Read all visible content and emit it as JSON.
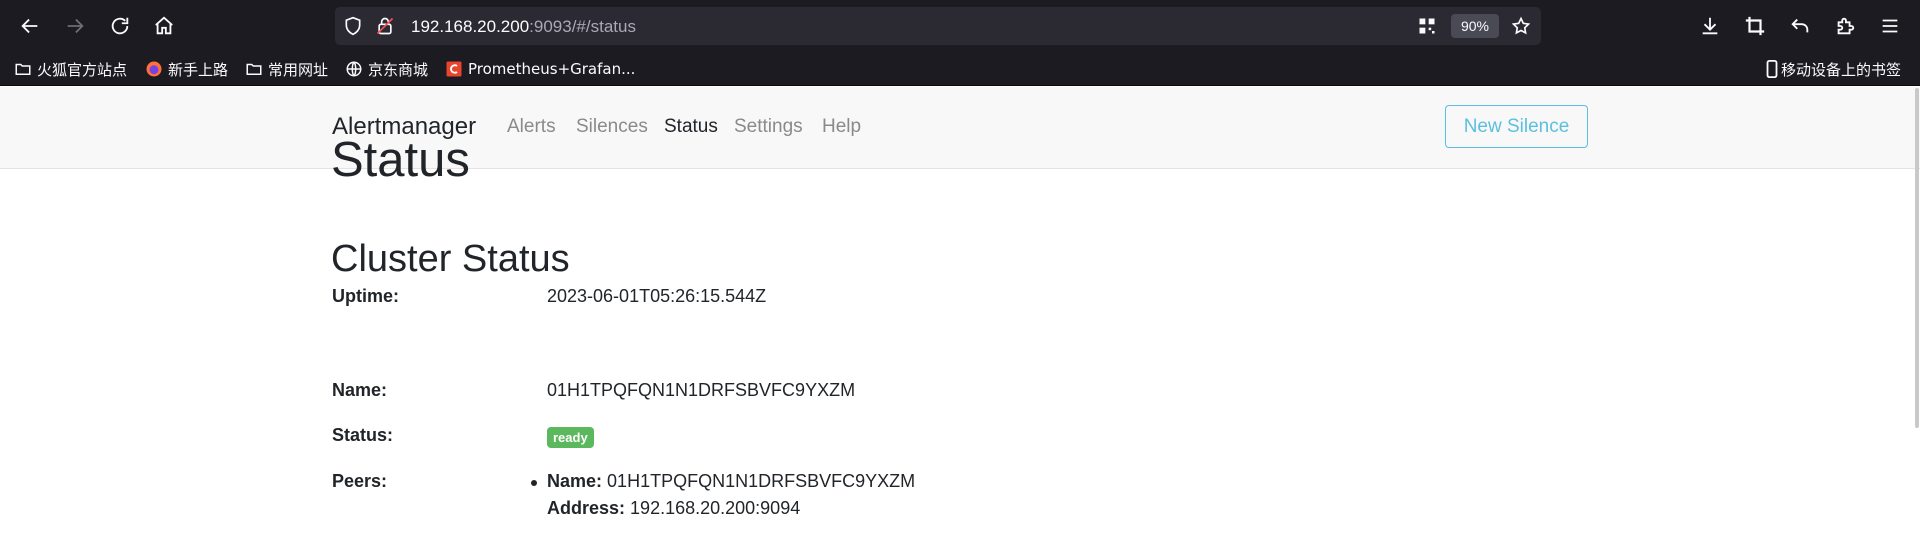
{
  "browser": {
    "url_host": "192.168.20.200",
    "url_rest": ":9093/#/status",
    "zoom": "90%",
    "bookmarks": [
      {
        "label": "火狐官方站点",
        "icon": "folder-icon"
      },
      {
        "label": "新手上路",
        "icon": "firefox-icon"
      },
      {
        "label": "常用网址",
        "icon": "folder-icon"
      },
      {
        "label": "京东商城",
        "icon": "globe-icon"
      },
      {
        "label": "Prometheus+Grafan...",
        "icon": "c-logo-icon"
      }
    ],
    "mobile_bookmarks": "移动设备上的书签"
  },
  "navbar": {
    "brand": "Alertmanager",
    "links": [
      "Alerts",
      "Silences",
      "Status",
      "Settings",
      "Help"
    ],
    "active": "Status",
    "new_silence": "New Silence"
  },
  "status": {
    "title": "Status",
    "uptime_label": "Uptime:",
    "uptime_value": "2023-06-01T05:26:15.544Z"
  },
  "cluster": {
    "title": "Cluster Status",
    "name_label": "Name:",
    "name_value": "01H1TPQFQN1N1DRFSBVFC9YXZM",
    "status_label": "Status:",
    "status_value": "ready",
    "peers_label": "Peers:",
    "peers": [
      {
        "name_label": "Name:",
        "name": "01H1TPQFQN1N1DRFSBVFC9YXZM",
        "address_label": "Address:",
        "address": "192.168.20.200:9094"
      }
    ]
  },
  "colors": {
    "toolbar": "#1c1b22",
    "urlbar": "#2b2a33",
    "accent": "#5bc0de",
    "ready_badge": "#5cb85c"
  }
}
